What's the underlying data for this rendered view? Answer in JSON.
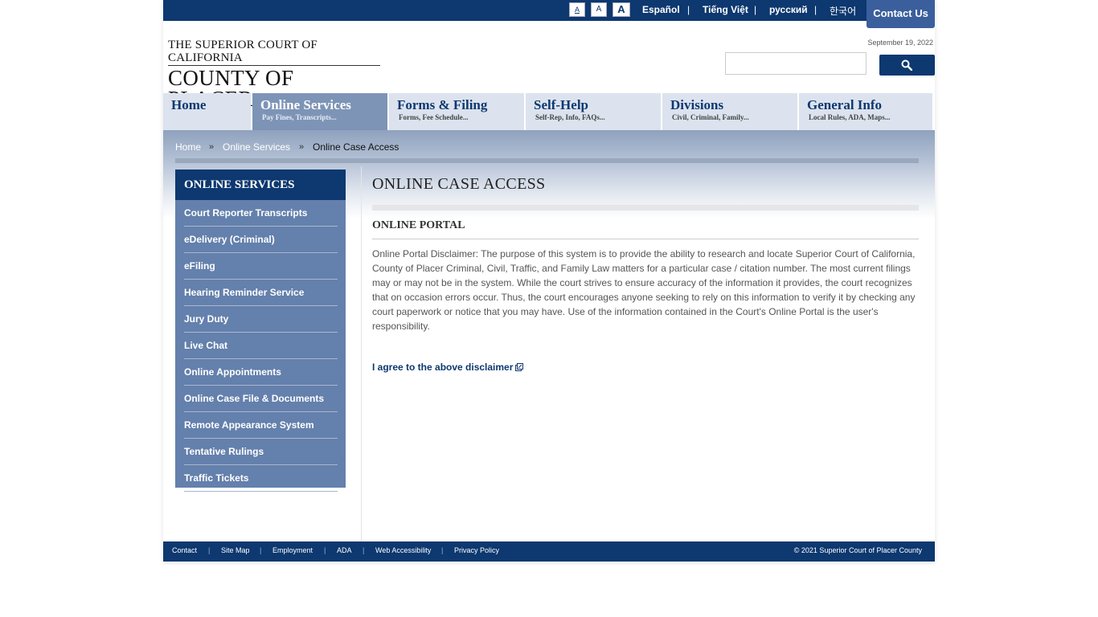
{
  "topbar": {
    "font_sizes": [
      "A",
      "A",
      "A"
    ],
    "languages": [
      "Español",
      "Tiếng Việt",
      "русский",
      "한국어"
    ],
    "separator": "|",
    "contact_label": "Contact Us"
  },
  "header": {
    "logo_line1": "THE SUPERIOR COURT OF CALIFORNIA",
    "logo_line2": "COUNTY OF PLACER",
    "date": "September 19, 2022",
    "search_placeholder": ""
  },
  "nav": {
    "tabs": [
      {
        "label": "Home",
        "sub": ""
      },
      {
        "label": "Online Services",
        "sub": "Pay Fines, Transcripts..."
      },
      {
        "label": "Forms & Filing",
        "sub": "Forms, Fee Schedule..."
      },
      {
        "label": "Self-Help",
        "sub": "Self-Rep, Info, FAQs..."
      },
      {
        "label": "Divisions",
        "sub": "Civil, Criminal, Family..."
      },
      {
        "label": "General Info",
        "sub": "Local Rules, ADA, Maps..."
      }
    ]
  },
  "breadcrumb": {
    "items": [
      "Home",
      "Online Services",
      "Online Case Access"
    ],
    "separator": "»"
  },
  "sidebar": {
    "title": "ONLINE SERVICES",
    "items": [
      "Court Reporter Transcripts",
      "eDelivery (Criminal)",
      "eFiling",
      "Hearing Reminder Service",
      "Jury Duty",
      "Live Chat",
      "Online Appointments",
      "Online Case File & Documents",
      "Remote Appearance System",
      "Tentative Rulings",
      "Traffic Tickets"
    ]
  },
  "main": {
    "title": "ONLINE CASE ACCESS",
    "section_heading": "ONLINE PORTAL",
    "disclaimer": "Online Portal Disclaimer: The purpose of this system is to provide the ability to research and locate Superior Court of California, County of Placer Criminal, Civil, Traffic, and Family Law matters for a particular case / citation number. The most current filings may or may not be in the system. While the court strives to ensure accuracy of the information it provides, the court recognizes that on occasion errors occur. Thus, the court encourages anyone seeking to rely on this information to verify it by checking any court paperwork or notice that you may have. Use of the information contained in the Court's Online Portal is the user's responsibility.",
    "agree_link": "I agree to the above disclaimer"
  },
  "footer": {
    "links": [
      "Contact",
      "Site Map",
      "Employment",
      "ADA",
      "Web Accessibility",
      "Privacy Policy"
    ],
    "separator": "|",
    "copyright": "© 2021 Superior Court of Placer County"
  },
  "colors": {
    "brand_navy": "#0d3870",
    "sidebar_blue": "#6480ac",
    "tab_inactive": "#dce3ee",
    "tab_active": "#7d94b6"
  },
  "icons": {
    "search": "search-icon",
    "external_link": "external-link-icon"
  }
}
